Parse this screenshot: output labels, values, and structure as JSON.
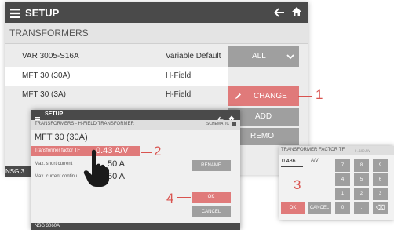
{
  "main": {
    "title": "SETUP",
    "subtitle": "TRANSFORMERS",
    "rows": [
      {
        "name": "VAR 3005-S16A",
        "type": "Variable Default"
      },
      {
        "name": "MFT 30 (30A)",
        "type": "H-Field"
      },
      {
        "name": "MFT 30 (3A)",
        "type": "H-Field"
      }
    ],
    "all_label": "ALL",
    "change_label": "CHANGE",
    "add_label": "ADD",
    "remove_label": "REMO",
    "status_text": "NSG 3"
  },
  "dialog": {
    "title": "SETUP",
    "subtitle": "TRANSFORMERS - H-FIELD TRANSFORMER",
    "schematic_label": "SCHEMATIC",
    "name": "MFT 30 (30A)",
    "fields": [
      {
        "label": "Transformer factor TF",
        "value": "0.43 A/V"
      },
      {
        "label": "Max. short current",
        "value": "50 A"
      },
      {
        "label": "Max. current continu",
        "value": "50 A"
      }
    ],
    "rename_label": "RENAME",
    "ok_label": "OK",
    "cancel_label": "CANCEL",
    "footer": "NSG 3060A"
  },
  "keypad": {
    "title": "TRANSFORMER FACTOR TF",
    "range": "0 - 100 A/V",
    "input_value": "0.486",
    "unit": "A/V",
    "keys": [
      "7",
      "8",
      "9",
      "4",
      "5",
      "6",
      "1",
      "2",
      "3",
      "0",
      ".",
      "⌫"
    ],
    "ok_label": "OK",
    "cancel_label": "CANCEL"
  },
  "callouts": [
    "1",
    "2",
    "3",
    "4"
  ],
  "colors": {
    "header": "#4a4a4a",
    "accent_red": "#e07a7a",
    "callout": "#d9534f",
    "button_grey": "#9f9f9f"
  }
}
